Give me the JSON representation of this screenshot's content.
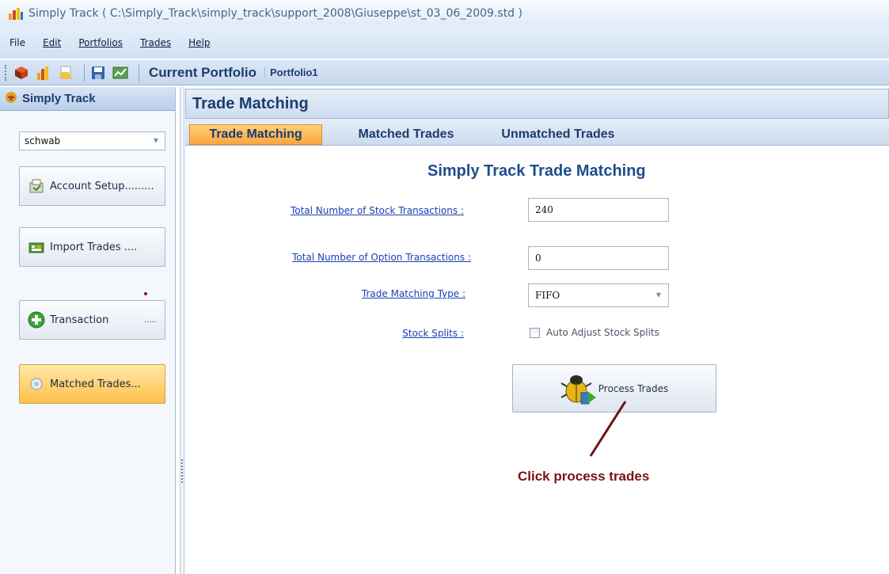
{
  "window": {
    "title": "Simply Track ( C:\\Simply_Track\\simply_track\\support_2008\\Giuseppe\\st_03_06_2009.std )"
  },
  "menu": {
    "items": [
      "File",
      "Edit",
      "Portfolios",
      "Trades",
      "Help"
    ]
  },
  "toolbar": {
    "icons": [
      "cube-icon",
      "bar-chart-icon",
      "open-folder-icon",
      "save-icon",
      "chart-icon"
    ],
    "current_portfolio_label": "Current Portfolio",
    "current_portfolio_value": "Portfolio1"
  },
  "sidebar": {
    "header": "Simply Track",
    "account_selected": "schwab",
    "buttons": [
      {
        "label": "Account Setup.........",
        "icon": "account-setup-icon"
      },
      {
        "label": "Import Trades ....",
        "icon": "import-icon"
      },
      {
        "label": "Transaction",
        "icon": "add-icon",
        "suffix": "....."
      },
      {
        "label": "Matched Trades...",
        "icon": "matched-trades-icon"
      }
    ]
  },
  "main": {
    "header": "Trade Matching",
    "tabs": [
      "Trade Matching",
      "Matched Trades",
      "Unmatched Trades"
    ],
    "active_tab": "Trade Matching",
    "form_title": "Simply Track Trade Matching",
    "fields": {
      "stock_label": "Total Number of Stock Transactions :",
      "stock_value": "240",
      "option_label": "Total Number of Option Transactions :",
      "option_value": "0",
      "matching_type_label": "Trade Matching Type :",
      "matching_type_value": "FIFO",
      "splits_label": "Stock Splits :",
      "splits_checkbox_label": "Auto Adjust Stock Splits",
      "splits_checked": false
    },
    "process_button": "Process Trades",
    "annotation": "Click process trades"
  },
  "colors": {
    "accent_orange": "#f9a63e",
    "header_blue": "#1c3c6c",
    "link_blue": "#1a3fb3",
    "annotation_red": "#7c1212"
  }
}
